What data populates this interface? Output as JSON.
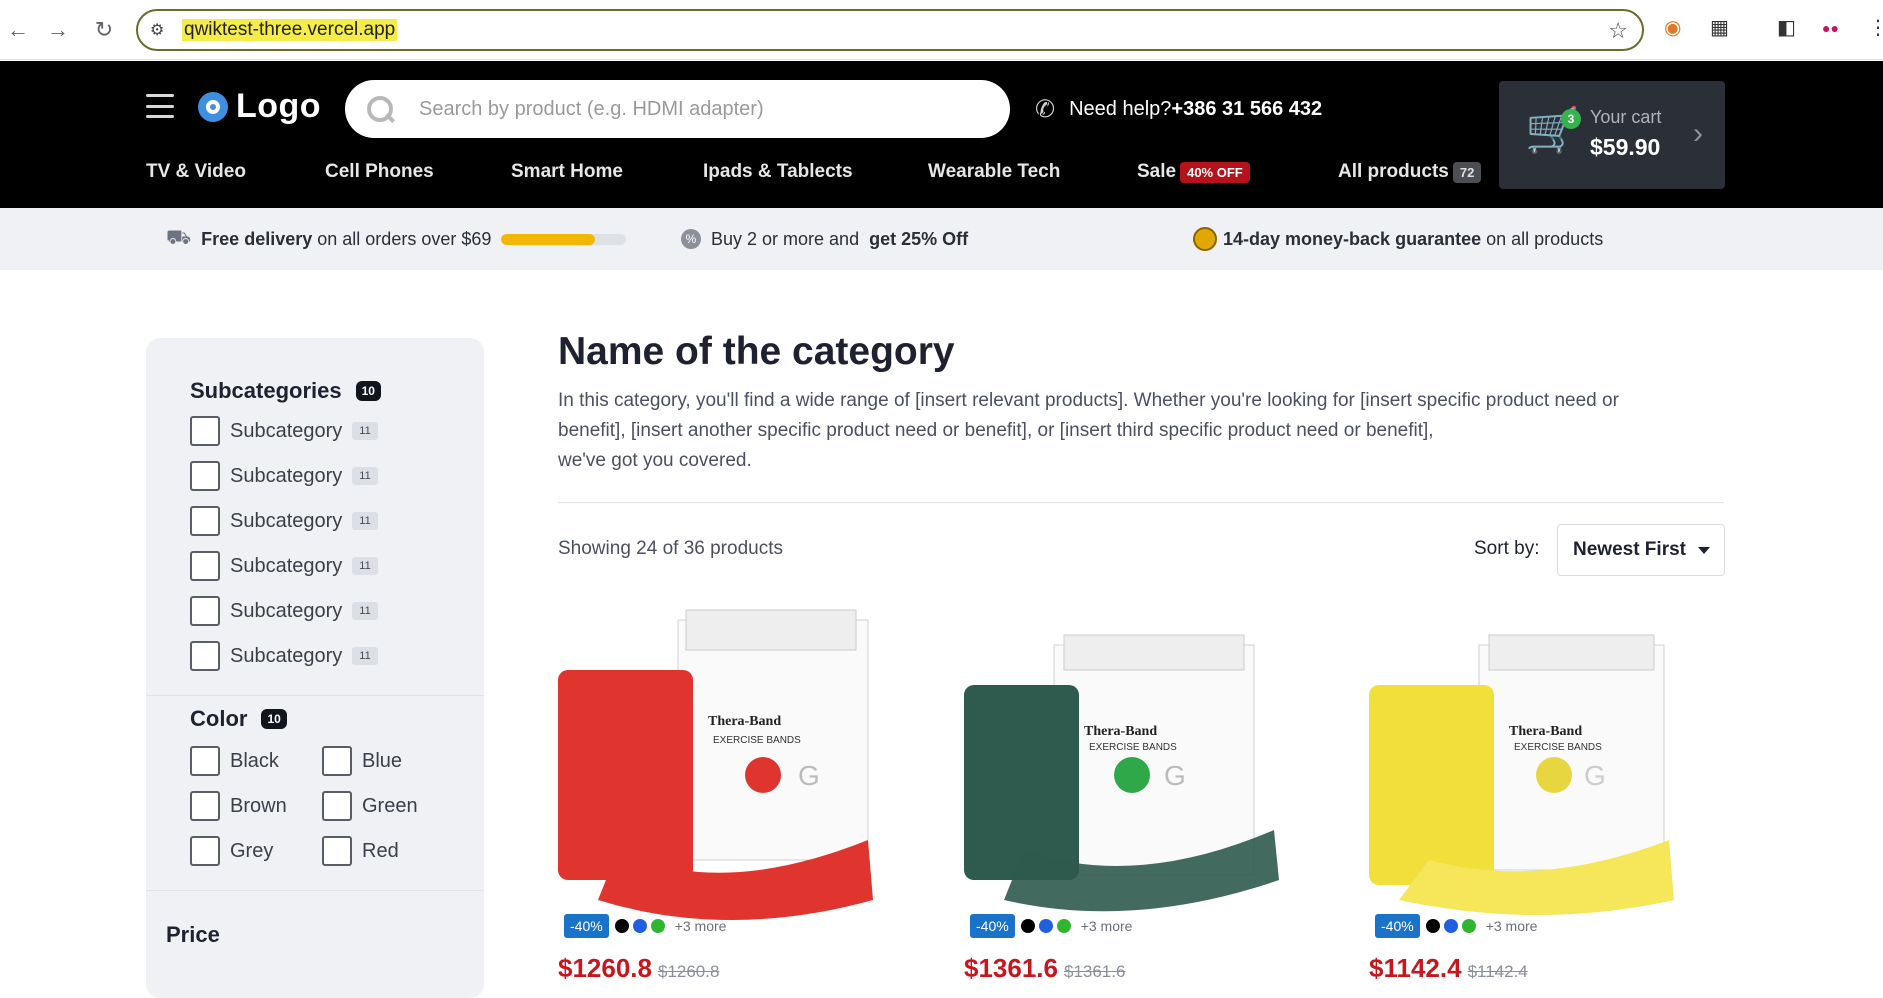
{
  "browser": {
    "url": "qwiktest-three.vercel.app"
  },
  "header": {
    "logo_text": "Logo",
    "search_placeholder": "Search by product (e.g. HDMI adapter)",
    "help_label": "Need help?",
    "help_phone": "+386 31 566 432",
    "cart": {
      "label": "Your cart",
      "total": "$59.90",
      "count": "3"
    },
    "categories": [
      {
        "label": "TV & Video"
      },
      {
        "label": "Cell Phones"
      },
      {
        "label": "Smart Home"
      },
      {
        "label": "Ipads & Tablects"
      },
      {
        "label": "Wearable Tech"
      },
      {
        "label": "Sale",
        "badge": "40% OFF"
      },
      {
        "label": "All products",
        "badge": "72"
      }
    ]
  },
  "promo": {
    "delivery_bold": "Free delivery",
    "delivery_rest": "on all orders over $69",
    "delivery_progress": 0.75,
    "buy_text": "Buy 2 or more and",
    "buy_bold": "get 25% Off",
    "guarantee_bold": "14-day money-back guarantee",
    "guarantee_rest": "on all products"
  },
  "sidebar": {
    "subcategories": {
      "title": "Subcategories",
      "count": "10",
      "items": [
        {
          "label": "Subcategory",
          "count": "11"
        },
        {
          "label": "Subcategory",
          "count": "11"
        },
        {
          "label": "Subcategory",
          "count": "11"
        },
        {
          "label": "Subcategory",
          "count": "11"
        },
        {
          "label": "Subcategory",
          "count": "11"
        },
        {
          "label": "Subcategory",
          "count": "11"
        }
      ]
    },
    "color": {
      "title": "Color",
      "count": "10",
      "options": [
        "Black",
        "Blue",
        "Brown",
        "Green",
        "Grey",
        "Red"
      ]
    },
    "price": {
      "title": "Price"
    }
  },
  "main": {
    "title": "Name of the category",
    "description_line1": "In this category, you'll find a wide range of [insert relevant products]. Whether you're looking for [insert specific product need or",
    "description_line2": "benefit], [insert another specific product need or benefit], or [insert third specific product need or benefit],",
    "description_line3": "we've got you covered.",
    "showing": "Showing 24 of 36 products",
    "sort_label": "Sort by:",
    "sort_value": "Newest First"
  },
  "products": [
    {
      "discount": "-40%",
      "more": "+3 more",
      "price": "$1260.8",
      "old_price": "$1260.8",
      "band_color": "#e0342f",
      "brand": "Thera-Band",
      "box_text": "EXERCISE BANDS"
    },
    {
      "discount": "-40%",
      "more": "+3 more",
      "price": "$1361.6",
      "old_price": "$1361.6",
      "band_color": "#2f5a4e",
      "brand": "Thera-Band",
      "box_text": "EXERCISE BANDS"
    },
    {
      "discount": "-40%",
      "more": "+3 more",
      "price": "$1142.4",
      "old_price": "$1142.4",
      "band_color": "#f2e03a",
      "brand": "Thera-Band",
      "box_text": "EXERCISE BANDS"
    }
  ],
  "swatch_colors": [
    "#000000",
    "#1f5fe0",
    "#2fb52f"
  ]
}
